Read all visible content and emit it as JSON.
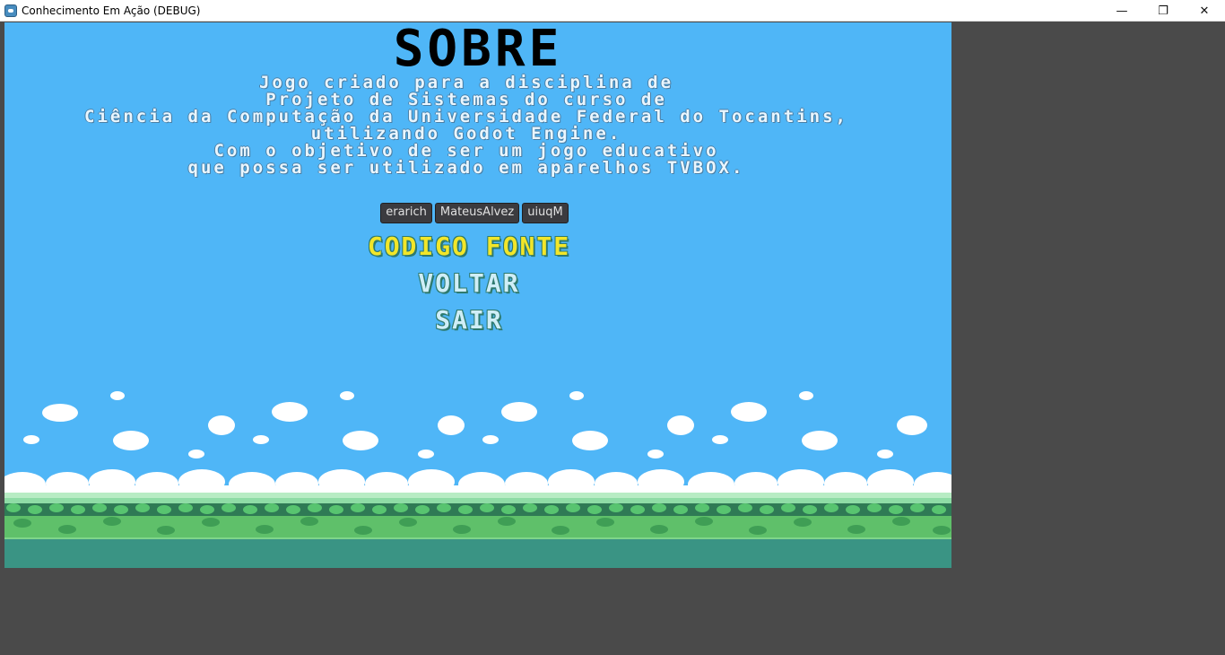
{
  "window": {
    "title": "Conhecimento Em Ação (DEBUG)",
    "minimize_glyph": "—",
    "restore_glyph": "❐",
    "close_glyph": "✕"
  },
  "screen": {
    "title": "SOBRE",
    "description_lines": [
      "Jogo criado para a disciplina de",
      "Projeto de Sistemas do curso de",
      "Ciência da Computação da Universidade Federal do Tocantins,",
      "utilizando Godot Engine.",
      "Com o objetivo de ser um jogo educativo",
      "que possa ser utilizado em aparelhos TVBOX."
    ],
    "authors": [
      "erarich",
      "MateusAlvez",
      "uiuqM"
    ],
    "buttons": {
      "source": "CODIGO FONTE",
      "back": "VOLTAR",
      "exit": "SAIR"
    }
  },
  "colors": {
    "sky": "#4fb6f7",
    "cloud": "#ffffff",
    "grass_light": "#9be3a5",
    "grass_dark": "#3a9a52",
    "ground": "#3a9484",
    "accent_yellow": "#f2e629"
  }
}
